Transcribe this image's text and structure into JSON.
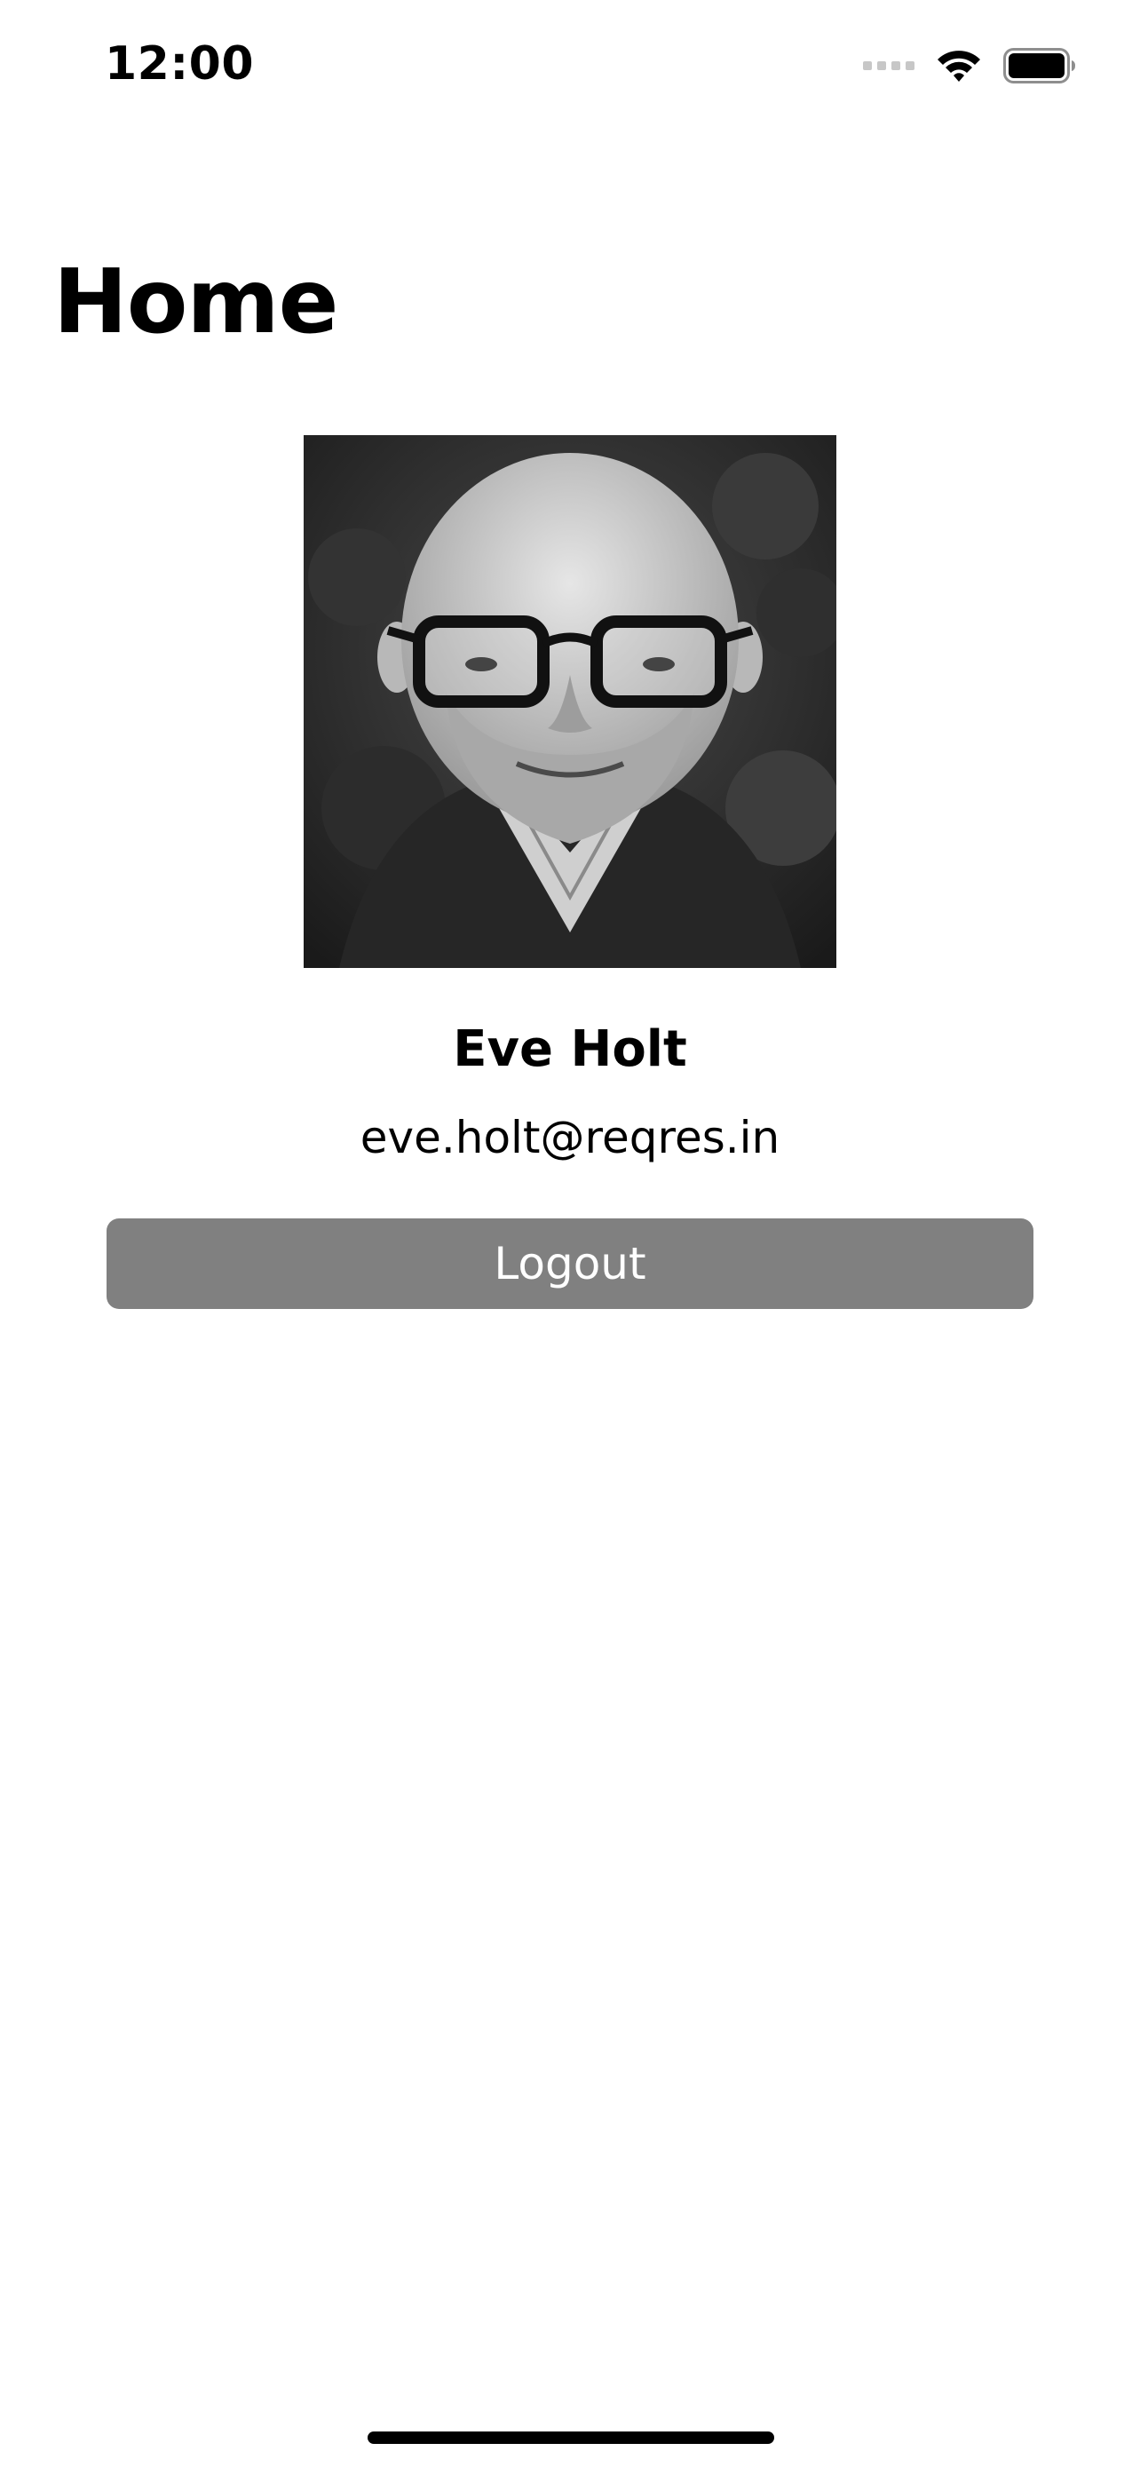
{
  "status_bar": {
    "time": "12:00",
    "icons": [
      "cellular-signal-icon",
      "wifi-icon",
      "battery-icon"
    ]
  },
  "page": {
    "title": "Home"
  },
  "profile": {
    "avatar": "user-avatar-photo",
    "name": "Eve Holt",
    "email": "eve.holt@reqres.in"
  },
  "actions": {
    "logout_label": "Logout"
  },
  "colors": {
    "background": "#ffffff",
    "text": "#000000",
    "button_background": "#808080",
    "button_text": "#ffffff"
  }
}
